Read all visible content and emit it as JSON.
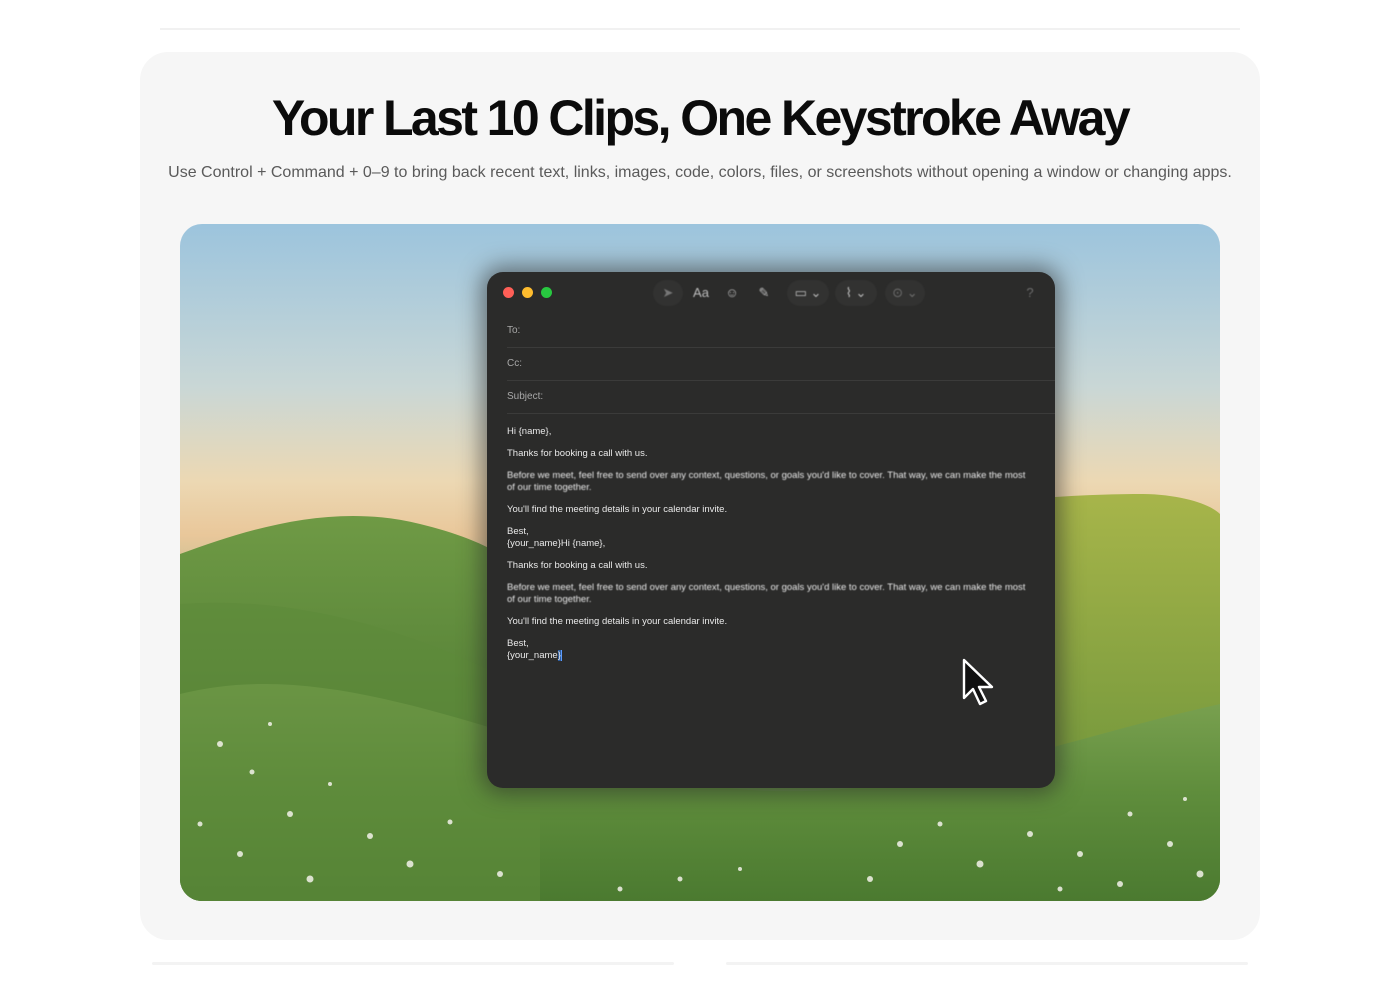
{
  "hero": {
    "title": "Your Last 10 Clips, One Keystroke Away",
    "subtitle": "Use Control + Command + 0–9 to bring back recent text, links, images, code, colors, files, or screenshots without opening a window or changing apps."
  },
  "mail": {
    "toolbar": {
      "format_label": "Aa"
    },
    "fields": {
      "to_label": "To:",
      "cc_label": "Cc:",
      "subject_label": "Subject:"
    },
    "body": {
      "p1": "Hi {name},",
      "p2": "Thanks for booking a call with us.",
      "p3": "Before we meet, feel free to send over any context, questions, or goals you'd like to cover. That way, we can make the most of our time together.",
      "p4": "You'll find the meeting details in your calendar invite.",
      "p5_line1": "Best,",
      "p5_line2": "{your_name}Hi {name},",
      "p6": "Thanks for booking a call with us.",
      "p7": "Before we meet, feel free to send over any context, questions, or goals you'd like to cover. That way, we can make the most of our time together.",
      "p8": "You'll find the meeting details in your calendar invite.",
      "p9_line1": "Best,",
      "p9_line2_prefix": "{your_name",
      "p9_line2_selected": "}"
    }
  },
  "colors": {
    "card_background": "#f6f6f6",
    "window_background": "#2b2b2a",
    "traffic_red": "#ff5f57",
    "traffic_yellow": "#febc2e",
    "traffic_green": "#28c840"
  }
}
